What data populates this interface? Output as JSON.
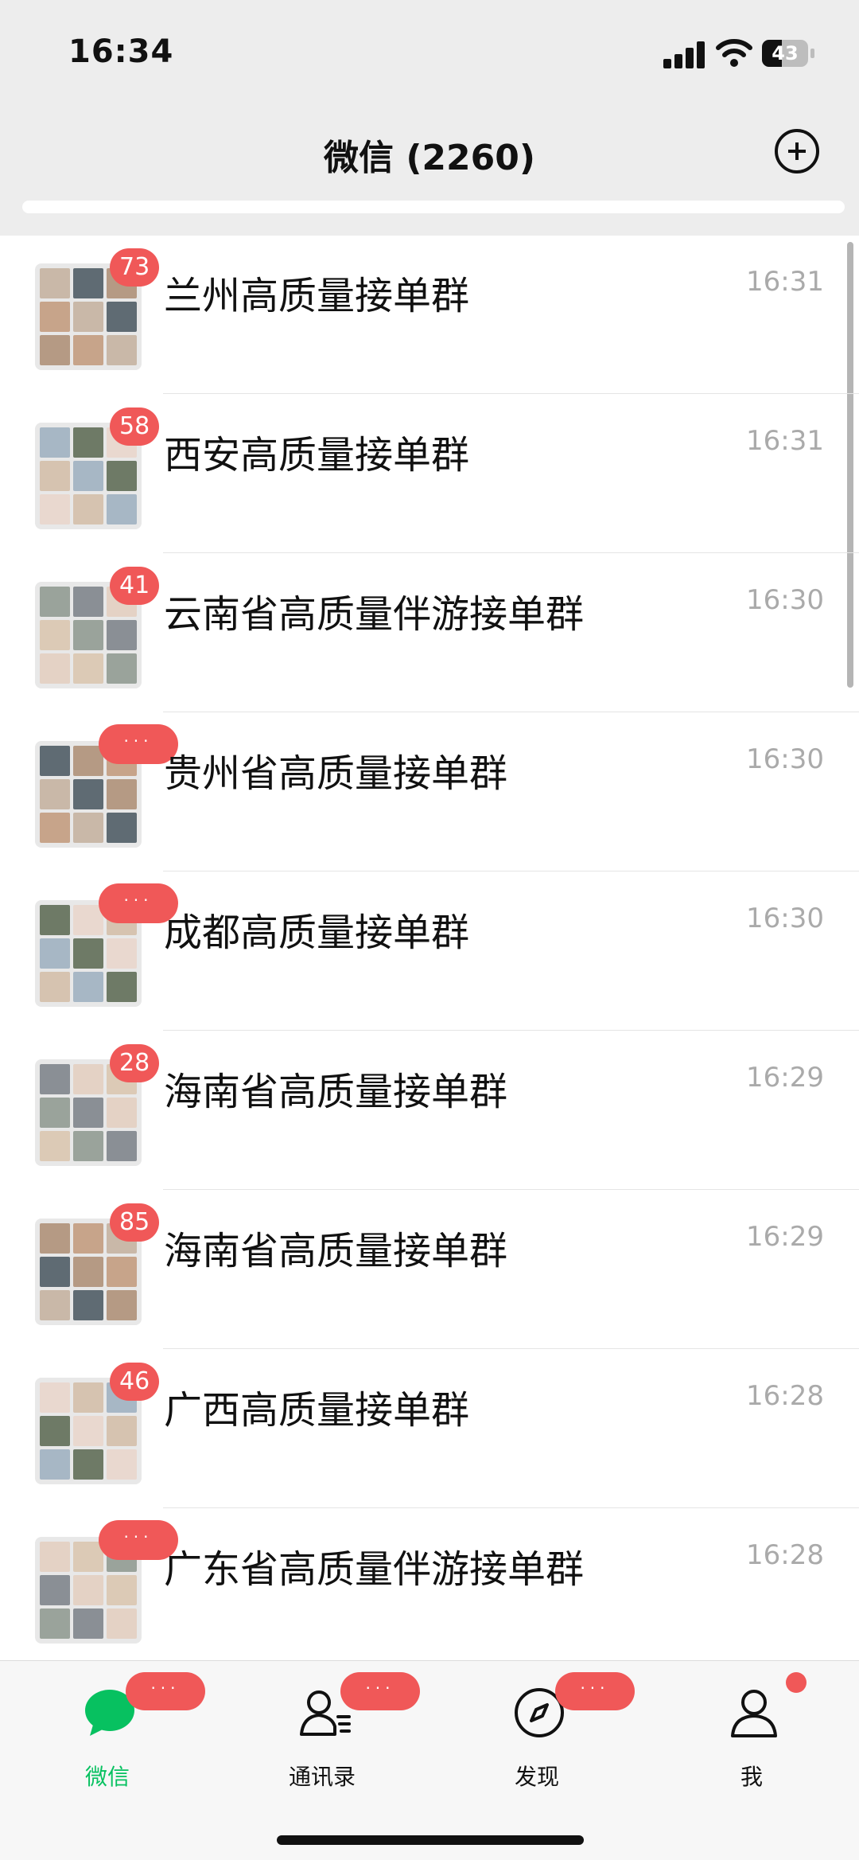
{
  "status": {
    "time": "16:34",
    "battery": "43"
  },
  "nav": {
    "title": "微信 (2260)"
  },
  "chats": [
    {
      "name": "兰州高质量接单群",
      "time": "16:31",
      "badge": "73"
    },
    {
      "name": "西安高质量接单群",
      "time": "16:31",
      "badge": "58"
    },
    {
      "name": "云南省高质量伴游接单群",
      "time": "16:30",
      "badge": "41"
    },
    {
      "name": "贵州省高质量接单群",
      "time": "16:30",
      "badge": "···"
    },
    {
      "name": "成都高质量接单群",
      "time": "16:30",
      "badge": "···"
    },
    {
      "name": "海南省高质量接单群",
      "time": "16:29",
      "badge": "28"
    },
    {
      "name": "海南省高质量接单群",
      "time": "16:29",
      "badge": "85"
    },
    {
      "name": "广西高质量接单群",
      "time": "16:28",
      "badge": "46"
    },
    {
      "name": "广东省高质量伴游接单群",
      "time": "16:28",
      "badge": "···"
    }
  ],
  "tabs": [
    {
      "label": "微信",
      "badge": "···",
      "icon": "chat-bubble-icon"
    },
    {
      "label": "通讯录",
      "badge": "···",
      "icon": "contacts-icon"
    },
    {
      "label": "发现",
      "badge": "···",
      "icon": "compass-icon"
    },
    {
      "label": "我",
      "badge": "",
      "icon": "person-icon"
    }
  ],
  "colors": {
    "accent": "#07c160",
    "badge": "#f05858"
  }
}
